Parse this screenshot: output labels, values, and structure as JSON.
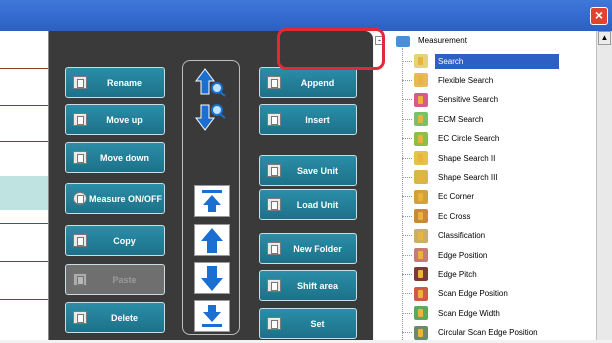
{
  "window": {
    "close_icon": "×"
  },
  "left_buttons": [
    {
      "label": "Rename",
      "icon": "rename-icon"
    },
    {
      "label": "Move up",
      "icon": "move-up-icon"
    },
    {
      "label": "Move down",
      "icon": "move-down-icon"
    },
    {
      "label": "Measure ON/OFF",
      "icon": "measure-toggle-icon"
    },
    {
      "label": "Copy",
      "icon": "copy-icon"
    },
    {
      "label": "Paste",
      "icon": "paste-icon",
      "disabled": true
    },
    {
      "label": "Delete",
      "icon": "delete-icon"
    }
  ],
  "arrow_buttons": [
    "scroll-top-search-icon",
    "scroll-bottom-search-icon",
    "scroll-top-icon",
    "arrow-up-icon",
    "arrow-down-icon",
    "scroll-bottom-icon"
  ],
  "right_buttons": [
    {
      "label": "Append"
    },
    {
      "label": "Insert"
    },
    {
      "label": "Save Unit"
    },
    {
      "label": "Load Unit"
    },
    {
      "label": "New Folder"
    },
    {
      "label": "Shift area"
    },
    {
      "label": "Set"
    }
  ],
  "tree": {
    "root": "Measurement",
    "items": [
      {
        "label": "Search",
        "selected": true,
        "color": "#e3d47a"
      },
      {
        "label": "Flexible Search",
        "color": "#e8b95a"
      },
      {
        "label": "Sensitive Search",
        "color": "#d85a8a"
      },
      {
        "label": "ECM Search",
        "color": "#7abf6a"
      },
      {
        "label": "EC Circle Search",
        "color": "#8ac04a"
      },
      {
        "label": "Shape Search II",
        "color": "#e4c24a"
      },
      {
        "label": "Shape Search III",
        "color": "#d9b64a"
      },
      {
        "label": "Ec Corner",
        "color": "#d4a03a"
      },
      {
        "label": "Ec Cross",
        "color": "#c88a3a"
      },
      {
        "label": "Classification",
        "color": "#c8b06a"
      },
      {
        "label": "Edge Position",
        "color": "#c77a7a"
      },
      {
        "label": "Edge Pitch",
        "color": "#7a3a3a"
      },
      {
        "label": "Scan Edge Position",
        "color": "#d05a4a"
      },
      {
        "label": "Scan Edge Width",
        "color": "#5aaa5a"
      },
      {
        "label": "Circular Scan Edge Position",
        "color": "#6a8a6a"
      }
    ]
  }
}
